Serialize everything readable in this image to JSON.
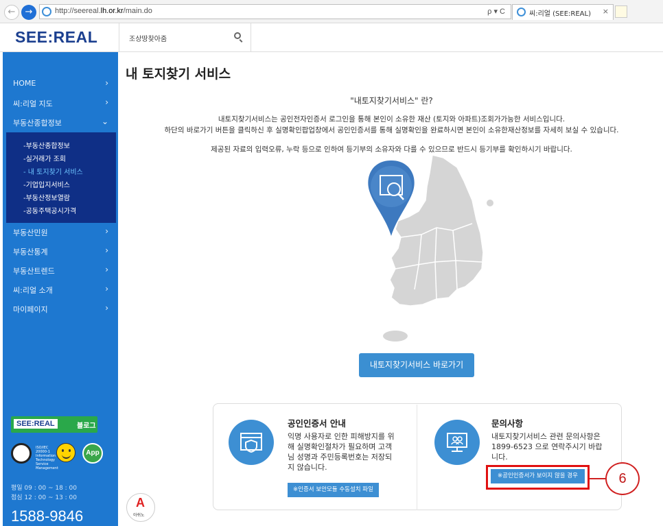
{
  "browser": {
    "url_prefix": "http://seereal.",
    "url_domain": "lh.or.kr",
    "url_suffix": "/main.do",
    "address_tools": "ρ ▾ C",
    "tab_title": "씨:리얼 (SEE:REAL)",
    "tab_close": "×"
  },
  "header": {
    "logo": "SEE:REAL",
    "search_placeholder": "조상땅찾아줌"
  },
  "sidebar": {
    "items": [
      {
        "label": "HOME",
        "chevron": "›"
      },
      {
        "label": "씨:리얼 지도",
        "chevron": "›"
      },
      {
        "label": "부동산종합정보",
        "chevron": "⌄"
      },
      {
        "label": "부동산민원",
        "chevron": "›"
      },
      {
        "label": "부동산통계",
        "chevron": "›"
      },
      {
        "label": "부동산트렌드",
        "chevron": "›"
      },
      {
        "label": "씨:리얼 소개",
        "chevron": "›"
      },
      {
        "label": "마이페이지",
        "chevron": "›"
      }
    ],
    "subitems": [
      {
        "label": "-부동산종합정보"
      },
      {
        "label": "-실거래가 조회"
      },
      {
        "label": "- 내 토지찾기 서비스"
      },
      {
        "label": "-기업입지서비스"
      },
      {
        "label": "-부동산정보열람"
      },
      {
        "label": "-공동주택공시가격"
      }
    ],
    "blog_logo": "SEE:REAL",
    "blog_label": "블로그",
    "cert_text": "ISO/IEC 20000-1 Information Technology Service Management",
    "app_label": "App",
    "hours_weekday": "평일 09 : 00 ~ 18 : 00",
    "hours_lunch": "점심 12 : 00 ~ 13 : 00",
    "phone": "1588-9846"
  },
  "main": {
    "title": "내 토지찾기 서비스",
    "question": "\"내토지찾기서비스\" 란?",
    "desc_line1": "내토지찾기서비스는 공인전자인증서 로그인을 통해 본인이 소유한 재산 (토지와 아파트)조회가가능한 서비스입니다.",
    "desc_line2": "하단의 바로가기 버튼을 클릭하신 후 실명확인팝업창에서 공인인증서를 통해 실명확인을 완료하시면 본인이 소유한재산정보를 자세히 보실 수 있습니다.",
    "desc_line3": "제공된 자료의 입력오류, 누락 등으로 인하여 등기부의 소유자와 다를 수 있으므로 반드시 등기부를 확인하시기 바랍니다.",
    "cta": "내토지찾기서비스 바로가기"
  },
  "info": {
    "cert": {
      "heading": "공인인증서 안내",
      "lines": [
        "익명 사용자로 인한 피해방지를 위",
        "해 실명확인절차가 필요하며 고객",
        "님 성명과 주민등록번호는 저장되",
        "지 않습니다."
      ],
      "button": "※인증서 보안모듈 수동설치 파일"
    },
    "inquiry": {
      "heading": "문의사항",
      "lines": [
        "내토지찾기서비스 관련 문의사항은",
        "1899-6523 으로 연락주시기 바랍",
        "니다."
      ],
      "button": "※공인인증서가 보이지 않을 경우"
    }
  },
  "callout": {
    "number": "6"
  },
  "floating": {
    "letter": "A",
    "text": "아쉬노"
  },
  "colors": {
    "sidebar": "#1e78d0",
    "submenu": "#0f2f86",
    "accent": "#3d8fd3",
    "highlight": "#e01010"
  }
}
